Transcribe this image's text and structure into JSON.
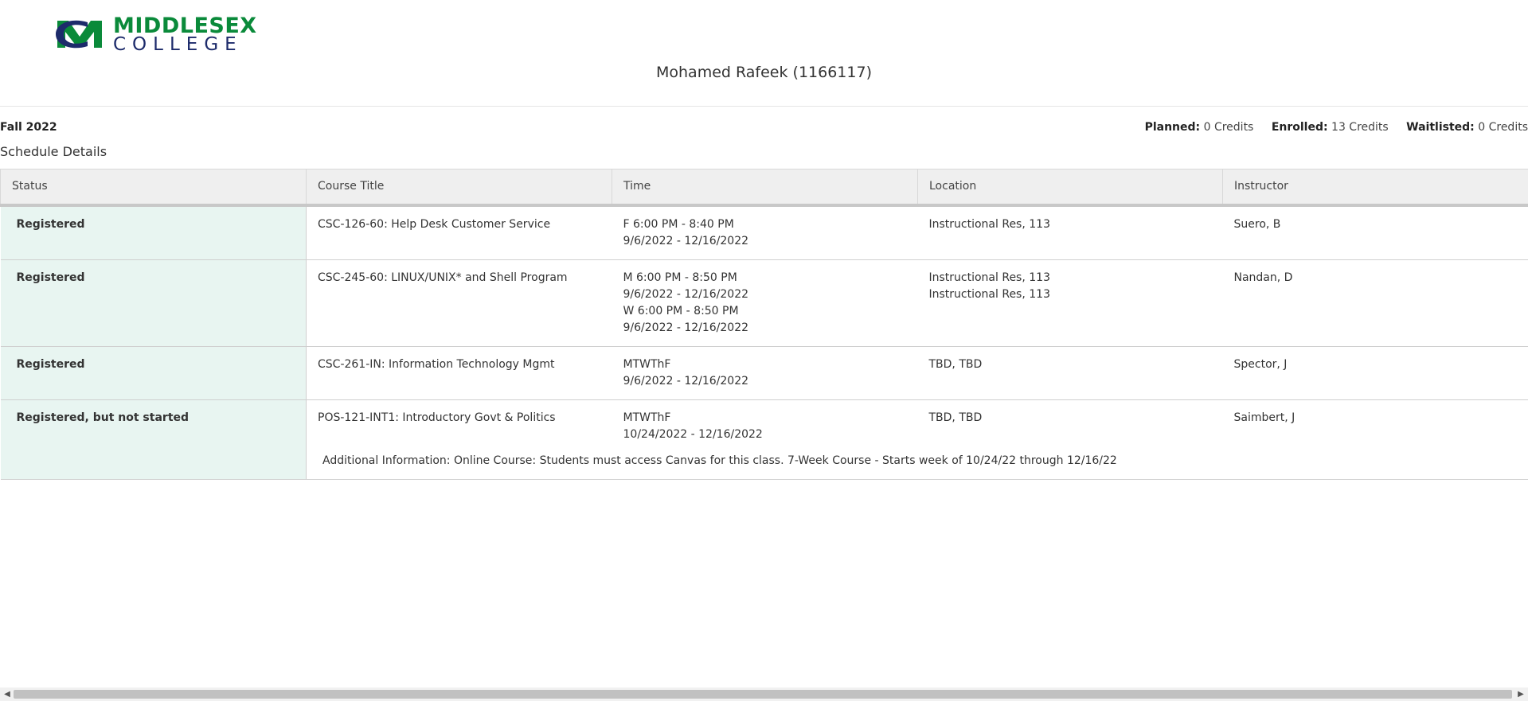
{
  "header": {
    "logo_line1": "MIDDLESEX",
    "logo_line2": "COLLEGE",
    "student_name": "Mohamed Rafeek (1166117)"
  },
  "term": {
    "name": "Fall 2022",
    "planned_label": "Planned:",
    "planned_value": "0 Credits",
    "enrolled_label": "Enrolled:",
    "enrolled_value": "13 Credits",
    "waitlisted_label": "Waitlisted:",
    "waitlisted_value": "0 Credits"
  },
  "section_title": "Schedule Details",
  "table": {
    "headers": [
      "Status",
      "Course Title",
      "Time",
      "Location",
      "Instructor"
    ],
    "rows": [
      {
        "status": "Registered",
        "course": "CSC-126-60: Help Desk Customer Service",
        "time": [
          "F 6:00 PM - 8:40 PM",
          "9/6/2022 - 12/16/2022"
        ],
        "location": [
          "Instructional Res, 113"
        ],
        "instructor": "Suero, B"
      },
      {
        "status": "Registered",
        "course": "CSC-245-60: LINUX/UNIX* and Shell Program",
        "time": [
          "M 6:00 PM - 8:50 PM",
          "9/6/2022 - 12/16/2022",
          "W 6:00 PM - 8:50 PM",
          "9/6/2022 - 12/16/2022"
        ],
        "location": [
          "Instructional Res, 113",
          "Instructional Res, 113"
        ],
        "instructor": "Nandan, D"
      },
      {
        "status": "Registered",
        "course": "CSC-261-IN: Information Technology Mgmt",
        "time": [
          "MTWThF",
          "9/6/2022 - 12/16/2022"
        ],
        "location": [
          "TBD, TBD"
        ],
        "instructor": "Spector, J"
      },
      {
        "status": "Registered, but not started",
        "course": "POS-121-INT1: Introductory Govt & Politics",
        "time": [
          "MTWThF",
          "10/24/2022 - 12/16/2022"
        ],
        "location": [
          "TBD, TBD"
        ],
        "instructor": "Saimbert, J",
        "additional_info": "Additional Information: Online Course: Students must access Canvas for this class. 7-Week Course - Starts week of 10/24/22 through 12/16/22"
      }
    ]
  },
  "colors": {
    "brand_green": "#0a8a3a",
    "brand_navy": "#1d2b6b",
    "status_bg": "#e8f5f1",
    "header_bg": "#efefef"
  }
}
